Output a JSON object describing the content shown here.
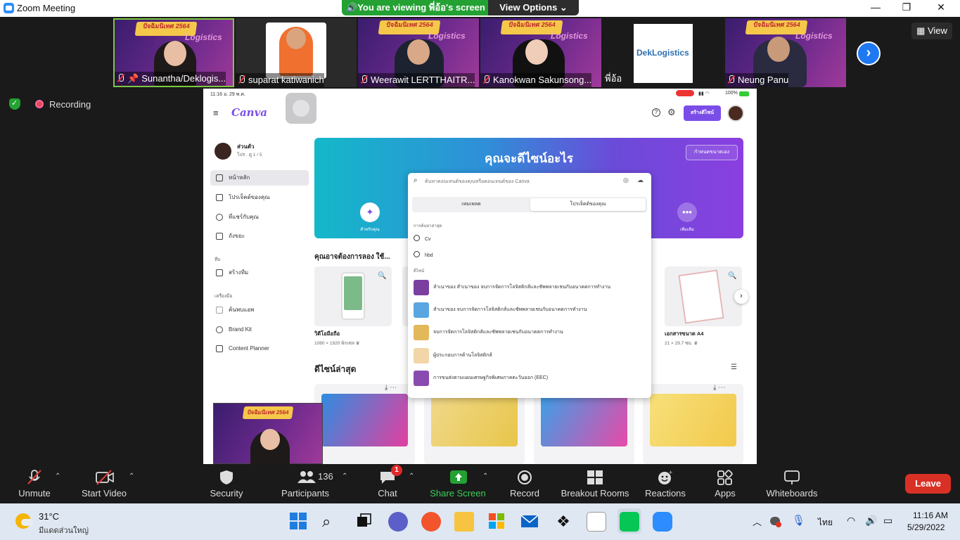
{
  "window": {
    "title": "Zoom Meeting",
    "minimize": "—",
    "maximize": "❐",
    "close": "✕"
  },
  "banner": {
    "viewing": "You are viewing พี่อ้อ's screen",
    "view_options": "View Options ⌄"
  },
  "view_button": "View",
  "participants": [
    {
      "name": "Sunantha/Deklogis...",
      "type": "slide"
    },
    {
      "name": "suparat katiwanich",
      "type": "photo"
    },
    {
      "name": "Weerawit LERTTHAITR...",
      "type": "slide"
    },
    {
      "name": "Kanokwan Sakunsong...",
      "type": "slide"
    },
    {
      "name": "พี่อ้อ",
      "type": "logo",
      "logo_text": "DekLogistics"
    },
    {
      "name": "Neung Panu",
      "type": "slide"
    }
  ],
  "slide_banner": "ปัจฉิมนิเทศ 2564",
  "slide_logistics": "Logistics",
  "recording": "Recording",
  "canva": {
    "status_time": "11:16  อ. 29 พ.ค.",
    "status_battery": "100%",
    "logo": "Canva",
    "create_design": "สร้างดีไซน์",
    "account_name": "ส่วนตัว",
    "account_sub": "โปร · ดู 1 / 5",
    "nav": [
      {
        "label": "หน้าหลัก"
      },
      {
        "label": "โปรเจ็คต์ของคุณ"
      },
      {
        "label": "ที่แชร์กับคุณ"
      },
      {
        "label": "ถังขยะ"
      }
    ],
    "team_section": "ทีม",
    "team_nav": [
      {
        "label": "สร้างทีม"
      }
    ],
    "tools_section": "เครื่องมือ",
    "tools_nav": [
      {
        "label": "ค้นพบแอพ"
      },
      {
        "label": "Brand Kit"
      },
      {
        "label": "Content Planner"
      }
    ],
    "hero_title": "คุณจะดีไซน์อะไร",
    "hero_custom": "กำหนดขนาดเอง",
    "hero_for_you": "สำหรับคุณ",
    "hero_more": "เพิ่มเติม",
    "search_placeholder": "ค้นหาคอนเทนต์ของคุณหรือคอนเทนต์ของ Canva",
    "search_tabs": [
      "เทมเพลต",
      "โปรเจ็คต์ของคุณ"
    ],
    "recent_searches_label": "การค้นหาล่าสุด",
    "recent_searches": [
      "Cv",
      "hbd"
    ],
    "designs_label": "ดีไซน์",
    "design_results": [
      {
        "title": "ลำเนาของ สำเนาของ จบการจัดการโลจิสติกส์และซัพพลายเชนกับอนาคตการทำงาน",
        "color": "#7b3fa0"
      },
      {
        "title": "สำเนาของ จบการจัดการโลจิสติกส์และซัพพลายเชนกับอนาคตการทำงาน",
        "color": "#5aa6e0"
      },
      {
        "title": "จบการจัดการโลจิสติกส์และซัพพลายเชนกับอนาคตการทำงาน",
        "color": "#e2b85a"
      },
      {
        "title": "ผู้ประกอบการด้านโลจิสติกส์",
        "color": "#f2d6a8"
      },
      {
        "title": "การขนส่งตามแผนเศรษฐกิจพิเศษภาคตะวันออก (EEC)",
        "color": "#8a4bb0"
      }
    ],
    "try_heading": "คุณอาจต้องการลอง ใช้...",
    "try_cards": [
      {
        "title": "วิดีโอมือถือ",
        "sub": "1080 × 1920 พิกเซล"
      },
      {
        "title": "เอกสารขนาด A4",
        "sub": "21 × 29.7 ซม."
      }
    ],
    "recent_heading": "ดีไซน์ล่าสุด",
    "recent_designs": [
      {
        "color": "#2e8de0"
      },
      {
        "color": "#e8c64a"
      },
      {
        "color": "#3aa0e8"
      },
      {
        "color": "#f2c94c"
      }
    ]
  },
  "toolbar": [
    {
      "label": "Unmute",
      "icon": "mic-muted-icon"
    },
    {
      "label": "Start Video",
      "icon": "video-off-icon"
    },
    {
      "label": "Security",
      "icon": "shield-icon"
    },
    {
      "label": "Participants",
      "icon": "people-icon",
      "count": "136"
    },
    {
      "label": "Chat",
      "icon": "chat-icon",
      "badge": "1"
    },
    {
      "label": "Share Screen",
      "icon": "share-icon"
    },
    {
      "label": "Record",
      "icon": "record-icon"
    },
    {
      "label": "Breakout Rooms",
      "icon": "breakout-icon"
    },
    {
      "label": "Reactions",
      "icon": "smile-icon"
    },
    {
      "label": "Apps",
      "icon": "apps-icon"
    },
    {
      "label": "Whiteboards",
      "icon": "whiteboard-icon"
    }
  ],
  "leave": "Leave",
  "taskbar": {
    "temp": "31°C",
    "weather": "มีแดดส่วนใหญ่",
    "lang": "ไทย",
    "time": "11:16 AM",
    "date": "5/29/2022"
  },
  "colors": {
    "zoom_blue": "#2D8CFF",
    "share_green": "#23a133",
    "leave_red": "#d93025",
    "canva_purple": "#7b4de8"
  }
}
